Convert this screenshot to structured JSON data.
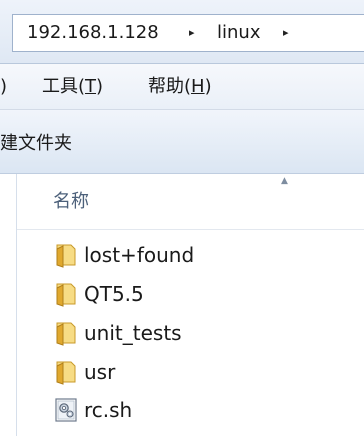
{
  "address_bar": {
    "crumbs": [
      "192.168.1.128",
      "linux"
    ],
    "separator": "▸"
  },
  "menu_bar": {
    "partial_left": ")",
    "tools": {
      "label": "工具(",
      "key": "T",
      "suffix": ")"
    },
    "help": {
      "label": "帮助(",
      "key": "H",
      "suffix": ")"
    }
  },
  "toolbar": {
    "new_folder_label": "建文件夹"
  },
  "file_list": {
    "column_name": "名称",
    "sort_indicator": "▲",
    "items": [
      {
        "label": "lost+found",
        "icon": "folder-icon"
      },
      {
        "label": "QT5.5",
        "icon": "folder-icon"
      },
      {
        "label": "unit_tests",
        "icon": "folder-icon"
      },
      {
        "label": "usr",
        "icon": "folder-icon"
      },
      {
        "label": "rc.sh",
        "icon": "script-file-icon"
      }
    ]
  },
  "colors": {
    "folder_yellow": "#f2c94c",
    "header_text": "#4c607a"
  }
}
